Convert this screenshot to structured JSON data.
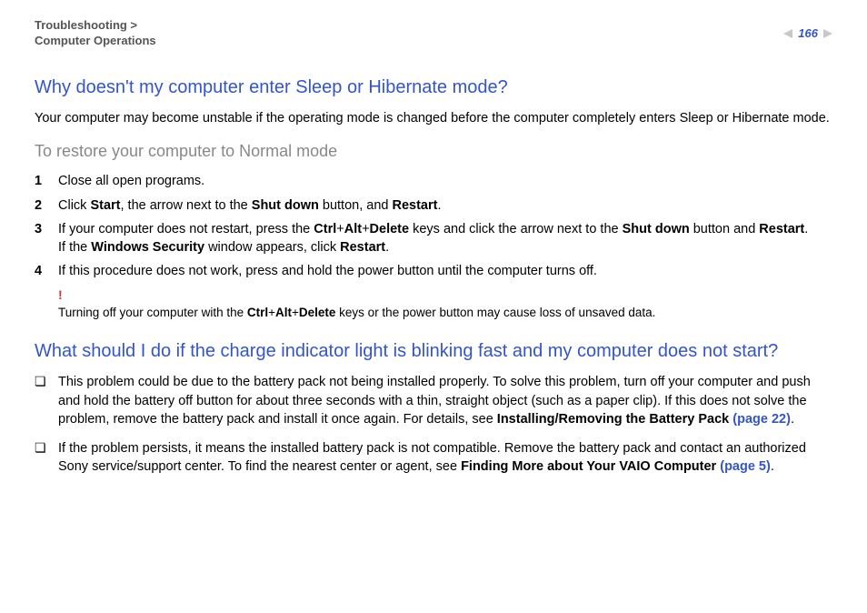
{
  "header": {
    "breadcrumb_line1": "Troubleshooting >",
    "breadcrumb_line2": "Computer Operations",
    "page_number": "166"
  },
  "section1": {
    "heading": "Why doesn't my computer enter Sleep or Hibernate mode?",
    "intro": "Your computer may become unstable if the operating mode is changed before the computer completely enters Sleep or Hibernate mode.",
    "subheading": "To restore your computer to Normal mode",
    "steps": [
      {
        "num": "1",
        "text": "Close all open programs."
      },
      {
        "num": "2",
        "prefix": "Click ",
        "b1": "Start",
        "mid1": ", the arrow next to the ",
        "b2": "Shut down",
        "mid2": " button, and ",
        "b3": "Restart",
        "suffix": "."
      },
      {
        "num": "3",
        "prefix": "If your computer does not restart, press the ",
        "b1": "Ctrl",
        "mid1": "+",
        "b2": "Alt",
        "mid2": "+",
        "b3": "Delete",
        "mid3": " keys and click the arrow next to the ",
        "b4": "Shut down",
        "mid4": " button and ",
        "b5": "Restart",
        "suffix": ".",
        "line2_prefix": "If the ",
        "line2_b1": "Windows Security",
        "line2_mid": " window appears, click ",
        "line2_b2": "Restart",
        "line2_suffix": "."
      },
      {
        "num": "4",
        "text": "If this procedure does not work, press and hold the power button until the computer turns off."
      }
    ],
    "warning": {
      "mark": "!",
      "prefix": "Turning off your computer with the ",
      "b1": "Ctrl",
      "mid1": "+",
      "b2": "Alt",
      "mid2": "+",
      "b3": "Delete",
      "suffix": " keys or the power button may cause loss of unsaved data."
    }
  },
  "section2": {
    "heading": "What should I do if the charge indicator light is blinking fast and my computer does not start?",
    "bullets": [
      {
        "prefix": "This problem could be due to the battery pack not being installed properly. To solve this problem, turn off your computer and push and hold the battery off button for about three seconds with a thin, straight object (such as a paper clip). If this does not solve the problem, remove the battery pack and install it once again. For details, see ",
        "b1": "Installing/Removing the Battery Pack ",
        "link": "(page 22)",
        "suffix": "."
      },
      {
        "prefix": "If the problem persists, it means the installed battery pack is not compatible. Remove the battery pack and contact an authorized Sony service/support center. To find the nearest center or agent, see ",
        "b1": "Finding More about Your VAIO Computer ",
        "link": "(page 5)",
        "suffix": "."
      }
    ]
  }
}
